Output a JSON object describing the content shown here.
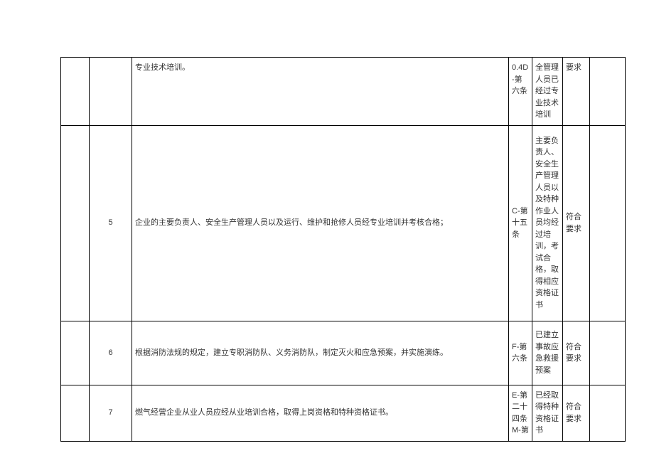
{
  "table": {
    "rows": [
      {
        "num": "",
        "content": "专业技术培训。",
        "ref": "0.4D-第六条",
        "detail": "全管理人员已经过专业技术培训",
        "status": "要求",
        "remark": ""
      },
      {
        "num": "5",
        "content": "企业的主要负责人、安全生产管理人员以及运行、维护和抢修人员经专业培训并考核合格；",
        "ref": "C-第十五条",
        "detail": "主要负责人、安全生产管理人员以及特种作业人员均经过培训，考试合格，取得相应资格证书",
        "status": "符合要求",
        "remark": ""
      },
      {
        "num": "6",
        "content": "根据消防法规的规定，建立专职消防队、义务消防队，制定灭火和应急预案，并实施演练。",
        "ref": "F-第六条",
        "detail": "已建立事故应急救援预案",
        "status": "符合要求",
        "remark": ""
      },
      {
        "num": "7",
        "content": "燃气经营企业从业人员应经从业培训合格，取得上岗资格和特种资格证书。",
        "ref": "E-第二十四条 M-第",
        "detail": "已经取得特种资格证书",
        "status": "符合要求",
        "remark": ""
      }
    ]
  }
}
